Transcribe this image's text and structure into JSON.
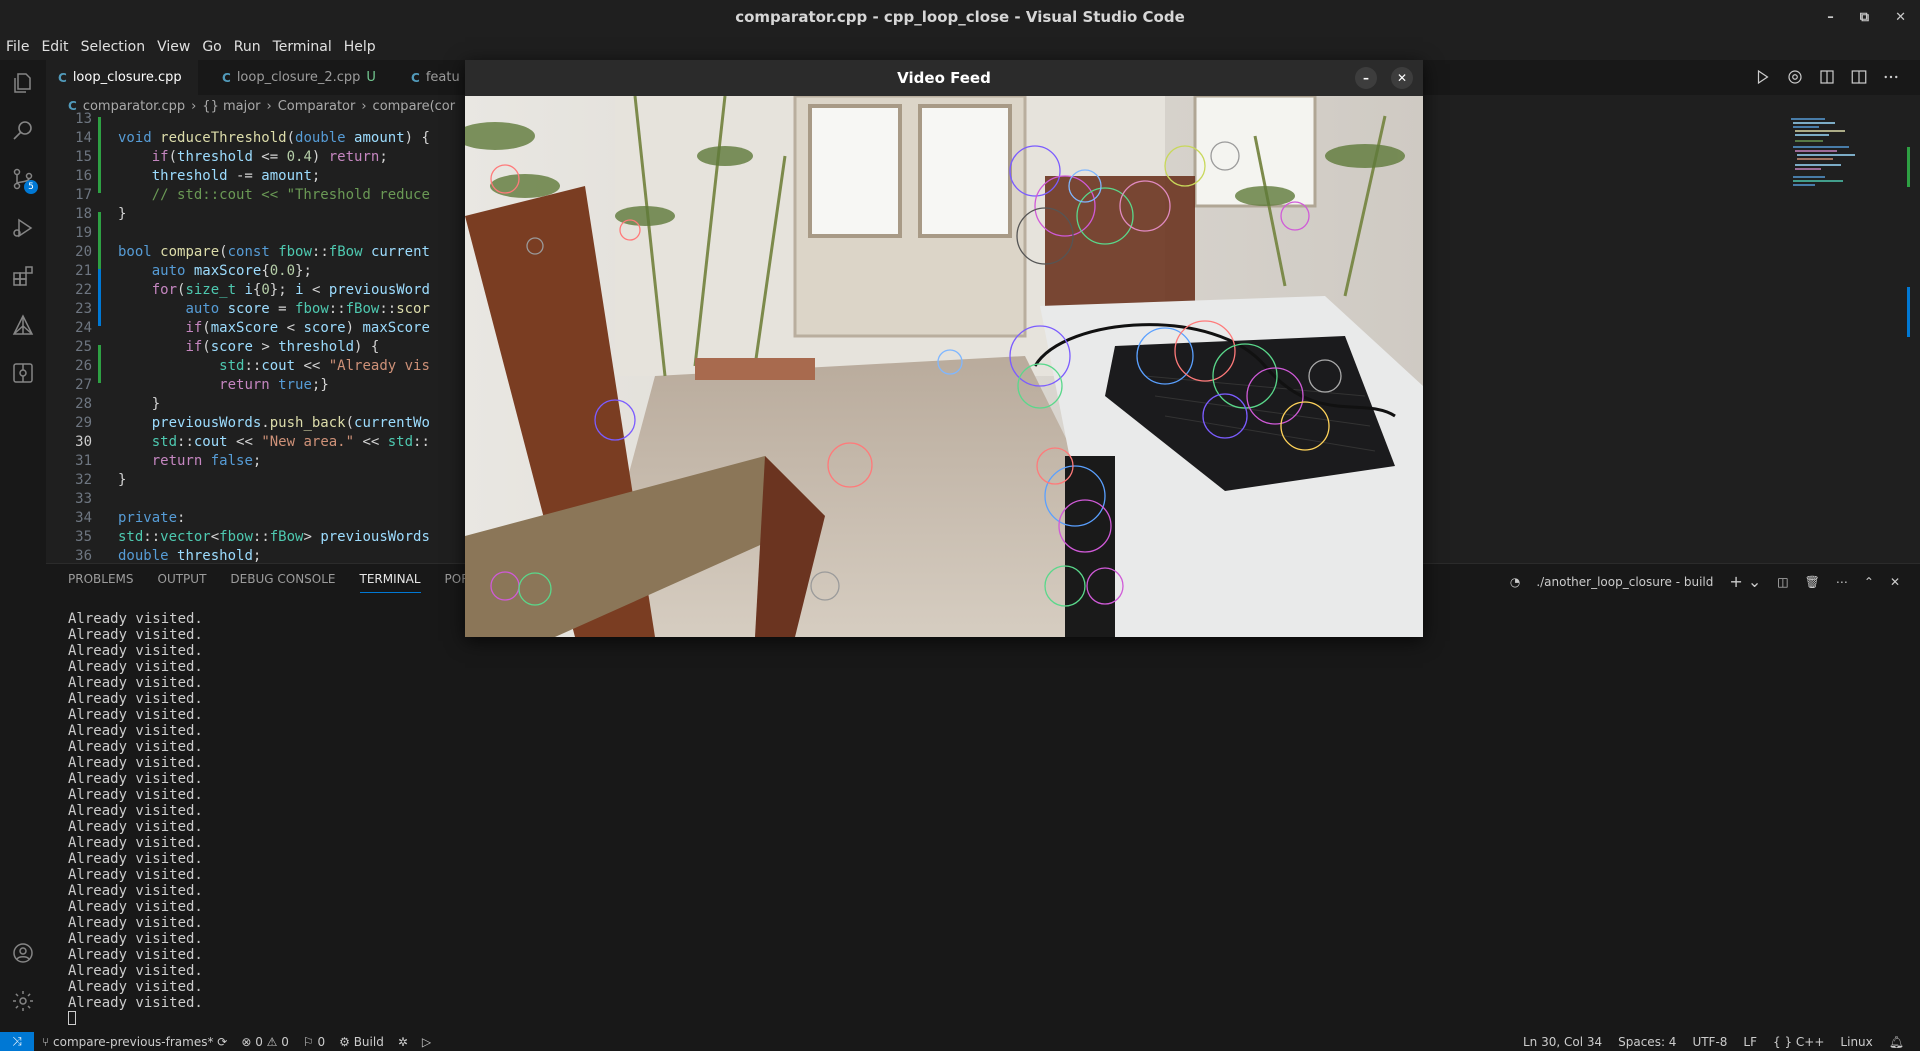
{
  "window": {
    "title": "comparator.cpp - cpp_loop_close - Visual Studio Code",
    "controls": [
      "–",
      "⧉",
      "✕"
    ]
  },
  "menu": [
    "File",
    "Edit",
    "Selection",
    "View",
    "Go",
    "Run",
    "Terminal",
    "Help"
  ],
  "activity_bar": {
    "items": [
      "explorer-icon",
      "search-icon",
      "source-control-icon",
      "run-debug-icon",
      "extensions-icon",
      "cmake-icon",
      "remote-explorer-icon"
    ],
    "scm_badge": "5",
    "bottom": [
      "account-icon",
      "settings-gear-icon"
    ]
  },
  "tabs": [
    {
      "icon": "C",
      "label": "loop_closure.cpp",
      "modified": ""
    },
    {
      "icon": "C",
      "label": "loop_closure_2.cpp",
      "modified": "U"
    },
    {
      "icon": "C",
      "label": "featu",
      "modified": ""
    }
  ],
  "breadcrumb": [
    "comparator.cpp",
    "{} major",
    "Comparator",
    "compare(cor"
  ],
  "code": {
    "first_line_number": "13",
    "lines": [
      {
        "n": "14",
        "tokens": [
          [
            "kw",
            "void"
          ],
          [
            "pl",
            " "
          ],
          [
            "fn",
            "reduceThreshold"
          ],
          [
            "pl",
            "("
          ],
          [
            "kw",
            "double"
          ],
          [
            "pl",
            " "
          ],
          [
            "vr",
            "amount"
          ],
          [
            "pl",
            ") {"
          ]
        ]
      },
      {
        "n": "15",
        "tokens": [
          [
            "pl",
            "    "
          ],
          [
            "kw2",
            "if"
          ],
          [
            "pl",
            "("
          ],
          [
            "vr",
            "threshold"
          ],
          [
            "pl",
            " <= "
          ],
          [
            "nm",
            "0.4"
          ],
          [
            "pl",
            ") "
          ],
          [
            "kw2",
            "return"
          ],
          [
            "pl",
            ";"
          ]
        ]
      },
      {
        "n": "16",
        "tokens": [
          [
            "pl",
            "    "
          ],
          [
            "vr",
            "threshold"
          ],
          [
            "pl",
            " -= "
          ],
          [
            "vr",
            "amount"
          ],
          [
            "pl",
            ";"
          ]
        ]
      },
      {
        "n": "17",
        "tokens": [
          [
            "pl",
            "    "
          ],
          [
            "cm",
            "// std::cout << \"Threshold reduce"
          ]
        ]
      },
      {
        "n": "18",
        "tokens": [
          [
            "pl",
            "}"
          ]
        ]
      },
      {
        "n": "19",
        "tokens": []
      },
      {
        "n": "20",
        "tokens": [
          [
            "kw",
            "bool"
          ],
          [
            "pl",
            " "
          ],
          [
            "fn",
            "compare"
          ],
          [
            "pl",
            "("
          ],
          [
            "kw",
            "const"
          ],
          [
            "pl",
            " "
          ],
          [
            "ty",
            "fbow"
          ],
          [
            "pl",
            "::"
          ],
          [
            "ty",
            "fBow"
          ],
          [
            "pl",
            " "
          ],
          [
            "vr",
            "current"
          ]
        ]
      },
      {
        "n": "21",
        "tokens": [
          [
            "pl",
            "    "
          ],
          [
            "kw",
            "auto"
          ],
          [
            "pl",
            " "
          ],
          [
            "vr",
            "maxScore"
          ],
          [
            "pl",
            "{"
          ],
          [
            "nm",
            "0.0"
          ],
          [
            "pl",
            "};"
          ]
        ]
      },
      {
        "n": "22",
        "tokens": [
          [
            "pl",
            "    "
          ],
          [
            "kw2",
            "for"
          ],
          [
            "pl",
            "("
          ],
          [
            "ty",
            "size_t"
          ],
          [
            "pl",
            " "
          ],
          [
            "vr",
            "i"
          ],
          [
            "pl",
            "{"
          ],
          [
            "nm",
            "0"
          ],
          [
            "pl",
            "}; "
          ],
          [
            "vr",
            "i"
          ],
          [
            "pl",
            " < "
          ],
          [
            "vr",
            "previousWord"
          ]
        ]
      },
      {
        "n": "23",
        "tokens": [
          [
            "pl",
            "        "
          ],
          [
            "kw",
            "auto"
          ],
          [
            "pl",
            " "
          ],
          [
            "vr",
            "score"
          ],
          [
            "pl",
            " = "
          ],
          [
            "ty",
            "fbow"
          ],
          [
            "pl",
            "::"
          ],
          [
            "ty",
            "fBow"
          ],
          [
            "pl",
            "::"
          ],
          [
            "fn",
            "scor"
          ]
        ]
      },
      {
        "n": "24",
        "tokens": [
          [
            "pl",
            "        "
          ],
          [
            "kw2",
            "if"
          ],
          [
            "pl",
            "("
          ],
          [
            "vr",
            "maxScore"
          ],
          [
            "pl",
            " < "
          ],
          [
            "vr",
            "score"
          ],
          [
            "pl",
            ") "
          ],
          [
            "vr",
            "maxScore"
          ]
        ]
      },
      {
        "n": "25",
        "tokens": [
          [
            "pl",
            "        "
          ],
          [
            "kw2",
            "if"
          ],
          [
            "pl",
            "("
          ],
          [
            "vr",
            "score"
          ],
          [
            "pl",
            " > "
          ],
          [
            "vr",
            "threshold"
          ],
          [
            "pl",
            ") {"
          ]
        ]
      },
      {
        "n": "26",
        "tokens": [
          [
            "pl",
            "            "
          ],
          [
            "ty",
            "std"
          ],
          [
            "pl",
            "::"
          ],
          [
            "vr",
            "cout"
          ],
          [
            "pl",
            " << "
          ],
          [
            "st",
            "\"Already vis"
          ]
        ]
      },
      {
        "n": "27",
        "tokens": [
          [
            "pl",
            "            "
          ],
          [
            "kw2",
            "return"
          ],
          [
            "pl",
            " "
          ],
          [
            "kw",
            "true"
          ],
          [
            "pl",
            ";}"
          ]
        ]
      },
      {
        "n": "28",
        "tokens": [
          [
            "pl",
            "    }"
          ]
        ]
      },
      {
        "n": "29",
        "tokens": [
          [
            "pl",
            "    "
          ],
          [
            "vr",
            "previousWords"
          ],
          [
            "pl",
            "."
          ],
          [
            "fn",
            "push_back"
          ],
          [
            "pl",
            "("
          ],
          [
            "vr",
            "currentWo"
          ]
        ]
      },
      {
        "n": "30",
        "tokens": [
          [
            "pl",
            "    "
          ],
          [
            "ty",
            "std"
          ],
          [
            "pl",
            "::"
          ],
          [
            "vr",
            "cout"
          ],
          [
            "pl",
            " << "
          ],
          [
            "st",
            "\"New area.\""
          ],
          [
            "pl",
            " << "
          ],
          [
            "ty",
            "std"
          ],
          [
            "pl",
            "::"
          ]
        ]
      },
      {
        "n": "31",
        "tokens": [
          [
            "pl",
            "    "
          ],
          [
            "kw2",
            "return"
          ],
          [
            "pl",
            " "
          ],
          [
            "kw",
            "false"
          ],
          [
            "pl",
            ";"
          ]
        ]
      },
      {
        "n": "32",
        "tokens": [
          [
            "pl",
            "}"
          ]
        ]
      },
      {
        "n": "33",
        "tokens": []
      },
      {
        "n": "34",
        "tokens": [
          [
            "kw",
            "private"
          ],
          [
            "pl",
            ":"
          ]
        ]
      },
      {
        "n": "35",
        "tokens": [
          [
            "ty",
            "std"
          ],
          [
            "pl",
            "::"
          ],
          [
            "ty",
            "vector"
          ],
          [
            "pl",
            "<"
          ],
          [
            "ty",
            "fbow"
          ],
          [
            "pl",
            "::"
          ],
          [
            "ty",
            "fBow"
          ],
          [
            "pl",
            "> "
          ],
          [
            "vr",
            "previousWords"
          ]
        ]
      },
      {
        "n": "36",
        "tokens": [
          [
            "kw",
            "double"
          ],
          [
            "pl",
            " "
          ],
          [
            "vr",
            "threshold"
          ],
          [
            "pl",
            ";"
          ]
        ]
      }
    ],
    "current_line": "30"
  },
  "panel": {
    "tabs": [
      "PROBLEMS",
      "OUTPUT",
      "DEBUG CONSOLE",
      "TERMINAL",
      "PORTS"
    ],
    "active_tab": "TERMINAL",
    "terminal_name": "./another_loop_closure - build",
    "terminal_lines": [
      "Already visited.",
      "Already visited.",
      "Already visited.",
      "Already visited.",
      "Already visited.",
      "Already visited.",
      "Already visited.",
      "Already visited.",
      "Already visited.",
      "Already visited.",
      "Already visited.",
      "Already visited.",
      "Already visited.",
      "Already visited.",
      "Already visited.",
      "Already visited.",
      "Already visited.",
      "Already visited.",
      "Already visited.",
      "Already visited.",
      "Already visited.",
      "Already visited.",
      "Already visited.",
      "Already visited.",
      "Already visited."
    ]
  },
  "status": {
    "branch": "compare-previous-frames*",
    "errors": "0",
    "warnings": "0",
    "ports": "0",
    "build": "Build",
    "position": "Ln 30, Col 34",
    "spaces": "Spaces: 4",
    "encoding": "UTF-8",
    "eol": "LF",
    "language": "C++",
    "platform": "Linux"
  },
  "video": {
    "title": "Video Feed",
    "minimize": "–",
    "close": "✕"
  },
  "colors": {
    "accent": "#0078d4",
    "editor_bg": "#1f1f1f",
    "sidebar_bg": "#181818"
  }
}
